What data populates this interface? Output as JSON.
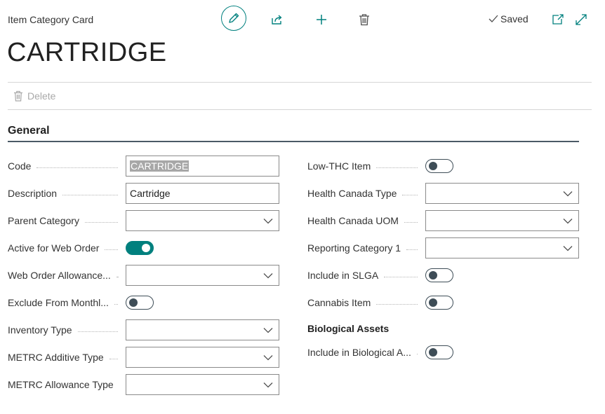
{
  "header": {
    "caption": "Item Category Card",
    "title": "CARTRIDGE",
    "saved_label": "Saved"
  },
  "toolbar": {
    "icons": [
      "edit-pencil-icon",
      "share-icon",
      "add-icon",
      "delete-trash-icon",
      "open-new-window-icon",
      "expand-icon"
    ]
  },
  "actionbar": {
    "delete_label": "Delete"
  },
  "section": {
    "title": "General"
  },
  "left_fields": [
    {
      "label": "Code",
      "type": "text",
      "value": "CARTRIDGE",
      "selected": true
    },
    {
      "label": "Description",
      "type": "text",
      "value": "Cartridge"
    },
    {
      "label": "Parent Category",
      "type": "dropdown",
      "value": ""
    },
    {
      "label": "Active for Web Order",
      "type": "toggle",
      "value": true
    },
    {
      "label": "Web Order Allowance...",
      "type": "dropdown",
      "value": ""
    },
    {
      "label": "Exclude From Monthl...",
      "type": "toggle",
      "value": false
    },
    {
      "label": "Inventory Type",
      "type": "dropdown",
      "value": ""
    },
    {
      "label": "METRC Additive Type",
      "type": "dropdown",
      "value": ""
    },
    {
      "label": "METRC Allowance Type",
      "type": "dropdown",
      "value": ""
    }
  ],
  "right_fields": [
    {
      "label": "Low-THC Item",
      "type": "toggle",
      "value": false
    },
    {
      "label": "Health Canada Type",
      "type": "dropdown",
      "value": ""
    },
    {
      "label": "Health Canada UOM",
      "type": "dropdown",
      "value": ""
    },
    {
      "label": "Reporting Category 1",
      "type": "dropdown",
      "value": ""
    },
    {
      "label": "Include in SLGA",
      "type": "toggle",
      "value": false
    },
    {
      "label": "Cannabis Item",
      "type": "toggle",
      "value": false
    }
  ],
  "biological": {
    "heading": "Biological Assets",
    "fields": [
      {
        "label": "Include in Biological A...",
        "type": "toggle",
        "value": false
      }
    ]
  },
  "colors": {
    "accent": "#00807e",
    "toggle_off": "#3e4d57",
    "section_rule": "#4b5a66"
  }
}
